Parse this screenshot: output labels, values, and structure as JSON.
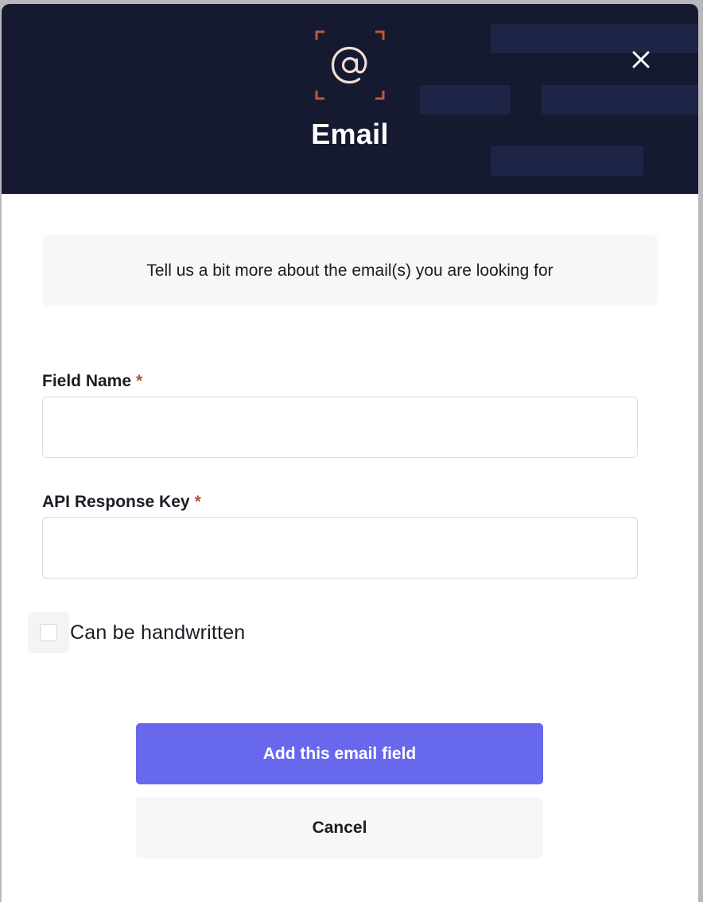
{
  "modal": {
    "title": "Email",
    "icon": "at-sign-icon",
    "close_icon": "close-icon"
  },
  "info": {
    "text": "Tell us a bit more about the email(s) you are looking for"
  },
  "form": {
    "field_name": {
      "label": "Field Name",
      "required_marker": "*",
      "value": "",
      "placeholder": ""
    },
    "api_response_key": {
      "label": "API Response Key",
      "required_marker": "*",
      "value": "",
      "placeholder": ""
    },
    "handwritten": {
      "label": "Can be handwritten",
      "checked": false
    }
  },
  "actions": {
    "submit_label": "Add this email field",
    "cancel_label": "Cancel"
  },
  "colors": {
    "header_bg": "#151a31",
    "accent": "#6868ec",
    "required": "#b5503a",
    "icon_corner": "#c4553c"
  }
}
